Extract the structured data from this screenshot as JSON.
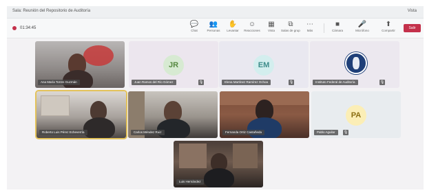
{
  "window": {
    "title": "Sala: Reunión del Repositorio de Auditoría",
    "view_label": "Vista"
  },
  "toolbar": {
    "recording_label": "01:34:45",
    "items": [
      {
        "label": "Chat",
        "icon": "chat-icon",
        "glyph": "💬"
      },
      {
        "label": "Personas",
        "icon": "people-icon",
        "glyph": "👥"
      },
      {
        "label": "Levantar",
        "icon": "raise-hand-icon",
        "glyph": "✋"
      },
      {
        "label": "Reacciones",
        "icon": "reaction-icon",
        "glyph": "☺"
      },
      {
        "label": "Vista",
        "icon": "view-icon",
        "glyph": "▦"
      },
      {
        "label": "Salas de grupo",
        "icon": "breakout-icon",
        "glyph": "⧉"
      },
      {
        "label": "Más",
        "icon": "more-icon",
        "glyph": "⋯"
      },
      {
        "label": "Cámara",
        "icon": "camera-icon",
        "glyph": "■"
      },
      {
        "label": "Micrófono",
        "icon": "mic-icon",
        "glyph": "🎤"
      },
      {
        "label": "Compartir",
        "icon": "share-icon",
        "glyph": "⬆"
      }
    ],
    "leave_label": "Salir",
    "colors": {
      "leave": "#c4314b"
    }
  },
  "participants": [
    {
      "name": "Ana María Torres Guzmán",
      "type": "video"
    },
    {
      "name": "Juan Ramos del Río Gómez",
      "type": "avatar",
      "initials": "JR",
      "avatar_bg": "#d7ead2",
      "avatar_fg": "#55883f"
    },
    {
      "name": "Elena Martínez Ramírez Ochoa",
      "type": "avatar",
      "initials": "EM",
      "avatar_bg": "#d3eeee",
      "avatar_fg": "#3d8c8a"
    },
    {
      "name": "Instituto Federal de Auditoría",
      "type": "logo"
    },
    {
      "name": "Roberto Luis Pérez Echeverría",
      "type": "video",
      "speaking": true
    },
    {
      "name": "Carlos Méndez Ruiz",
      "type": "video"
    },
    {
      "name": "Fernanda Ortiz Castañeda",
      "type": "video"
    },
    {
      "name": "Pablo Aguilar",
      "type": "avatar",
      "initials": "PA",
      "avatar_bg": "#fbeeb6",
      "avatar_fg": "#8a6d10"
    },
    {
      "name": "Luis Hernández",
      "type": "video"
    }
  ],
  "mic_glyph": "🎙"
}
